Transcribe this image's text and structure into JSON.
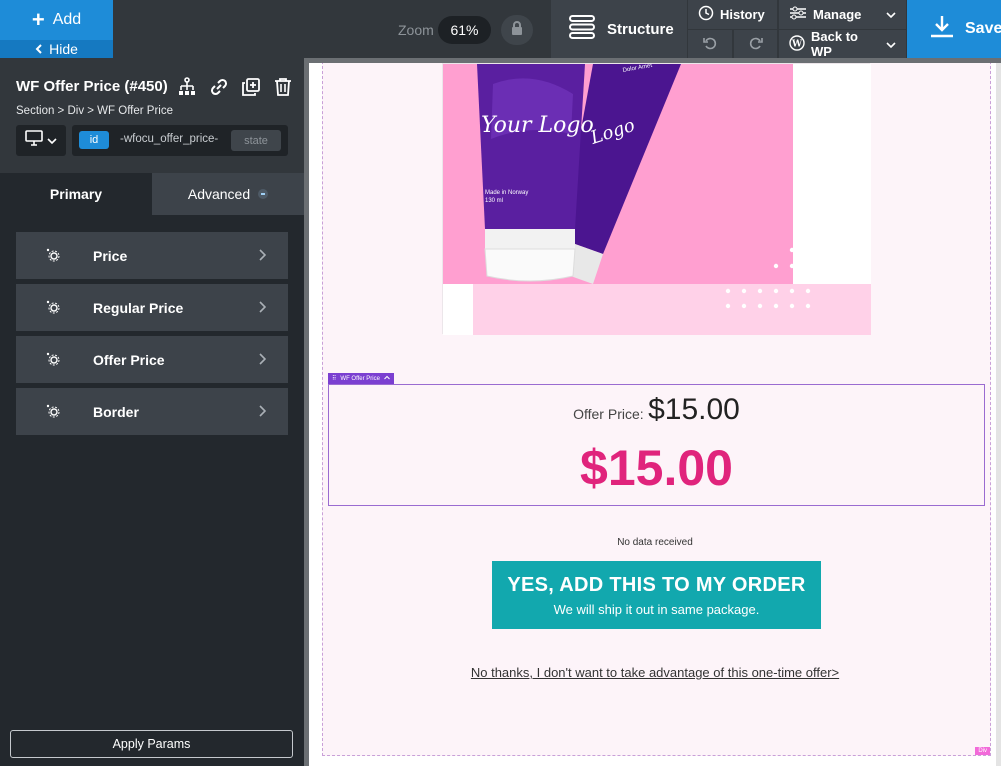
{
  "topbar": {
    "add_label": "Add",
    "hide_label": "Hide",
    "zoom_label": "Zoom",
    "zoom_value": "61%",
    "structure_label": "Structure",
    "history_label": "History",
    "manage_label": "Manage",
    "back_to_wp_label": "Back to WP",
    "save_label": "Save"
  },
  "panel": {
    "element_title": "WF Offer Price (#450)",
    "breadcrumb": "Section > Div > WF Offer Price",
    "selector_type": "id",
    "selector_value": "-wfocu_offer_price-",
    "state_label": "state",
    "tabs": {
      "primary": "Primary",
      "advanced": "Advanced"
    },
    "params": [
      {
        "label": "Price"
      },
      {
        "label": "Regular Price"
      },
      {
        "label": "Offer Price"
      },
      {
        "label": "Border"
      }
    ],
    "apply_label": "Apply Params"
  },
  "canvas": {
    "product_text": {
      "logo": "Your Logo",
      "logo2": "Logo",
      "made": "Made in Norway",
      "volume": "130 ml",
      "tag": "Dolor Amet"
    },
    "offer_tag_label": "WF Offer Price",
    "offer_label": "Offer Price:",
    "offer_price_small": "$15.00",
    "offer_price_big": "$15.00",
    "no_data": "No data received",
    "cta_main": "YES, ADD THIS TO MY ORDER",
    "cta_sub": "We will ship it out in same package.",
    "decline_link": "No thanks, I don't want to take advantage of this one-time offer>",
    "div_tag": "Div"
  },
  "colors": {
    "accent_blue": "#1e8cd8",
    "price_pink": "#e0247c",
    "cta_teal": "#12a8ae",
    "panel_dark": "#23282d",
    "tube_purple": "#5a1fa0",
    "product_bg_pink": "#ff9fd0"
  }
}
